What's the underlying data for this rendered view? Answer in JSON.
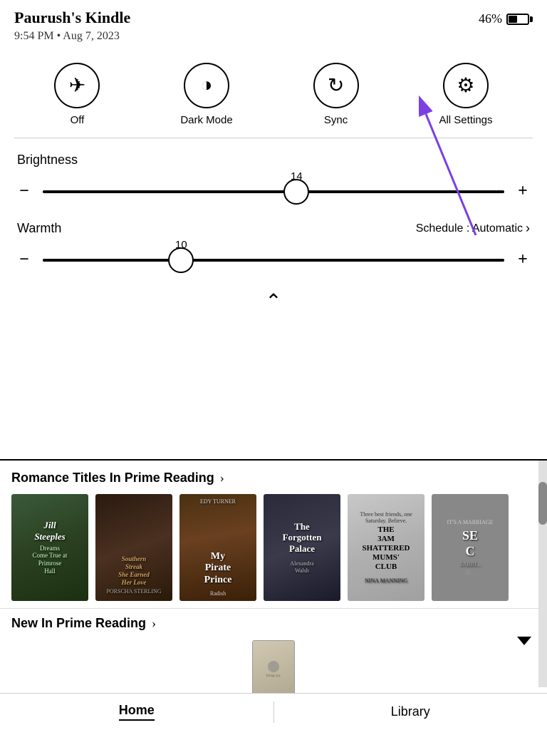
{
  "statusBar": {
    "deviceName": "Paurush's Kindle",
    "timeDate": "9:54 PM • Aug 7, 2023",
    "battery": "46%"
  },
  "quickSettings": {
    "buttons": [
      {
        "id": "airplane",
        "icon": "✈",
        "label": "Off"
      },
      {
        "id": "darkMode",
        "icon": "◑",
        "label": "Dark Mode"
      },
      {
        "id": "sync",
        "icon": "↻",
        "label": "Sync"
      },
      {
        "id": "allSettings",
        "icon": "⚙",
        "label": "All Settings"
      }
    ]
  },
  "brightness": {
    "label": "Brightness",
    "value": 14,
    "percent": 55,
    "minus": "−",
    "plus": "+"
  },
  "warmth": {
    "label": "Warmth",
    "scheduleLabel": "Schedule : Automatic",
    "value": 10,
    "percent": 30,
    "minus": "−",
    "plus": "+"
  },
  "romanceSection": {
    "title": "Romance Titles In Prime Reading",
    "books": [
      {
        "title": "Jill Steeples Dreams Come True at Primrose Hall",
        "author": "",
        "label": "Steeples Come"
      },
      {
        "title": "Southern Streak Her Earned Her Love",
        "author": "Porscha Sterling",
        "label": ""
      },
      {
        "title": "My Pirate Prince",
        "author": "Edy Turner / Radish",
        "label": ""
      },
      {
        "title": "The Forgotten Palace",
        "author": "Alexandra Walsh",
        "label": "The Forgotten Palace Alexandra Walsh"
      },
      {
        "title": "The 3am Shattered Mums' Club",
        "author": "Nina Manning",
        "label": ""
      },
      {
        "title": "SEd",
        "author": "Sabri...",
        "label": "SEd"
      }
    ]
  },
  "newPrimeSection": {
    "title": "New In Prime Reading"
  },
  "bottomNav": {
    "home": "Home",
    "library": "Library"
  },
  "annotation": {
    "arrowLabel": "All Settings arrow annotation"
  }
}
